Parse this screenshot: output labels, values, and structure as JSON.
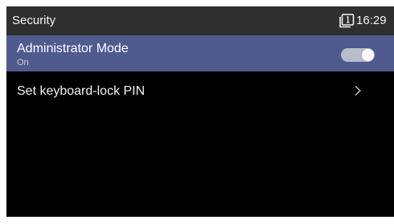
{
  "header": {
    "title": "Security",
    "time": "16:29",
    "status_icon": "sim-card-1-icon"
  },
  "settings": [
    {
      "label": "Administrator Mode",
      "sublabel": "On",
      "control": "toggle",
      "toggle_on": true
    },
    {
      "label": "Set keyboard-lock PIN",
      "control": "chevron-right-icon"
    }
  ],
  "colors": {
    "background": "#000000",
    "status_bar": "#2f2f2f",
    "selected_row": "#4f5a8e",
    "toggle_track": "#b9bcc9",
    "toggle_knob": "#ffffff",
    "text": "#f2f2f2"
  }
}
